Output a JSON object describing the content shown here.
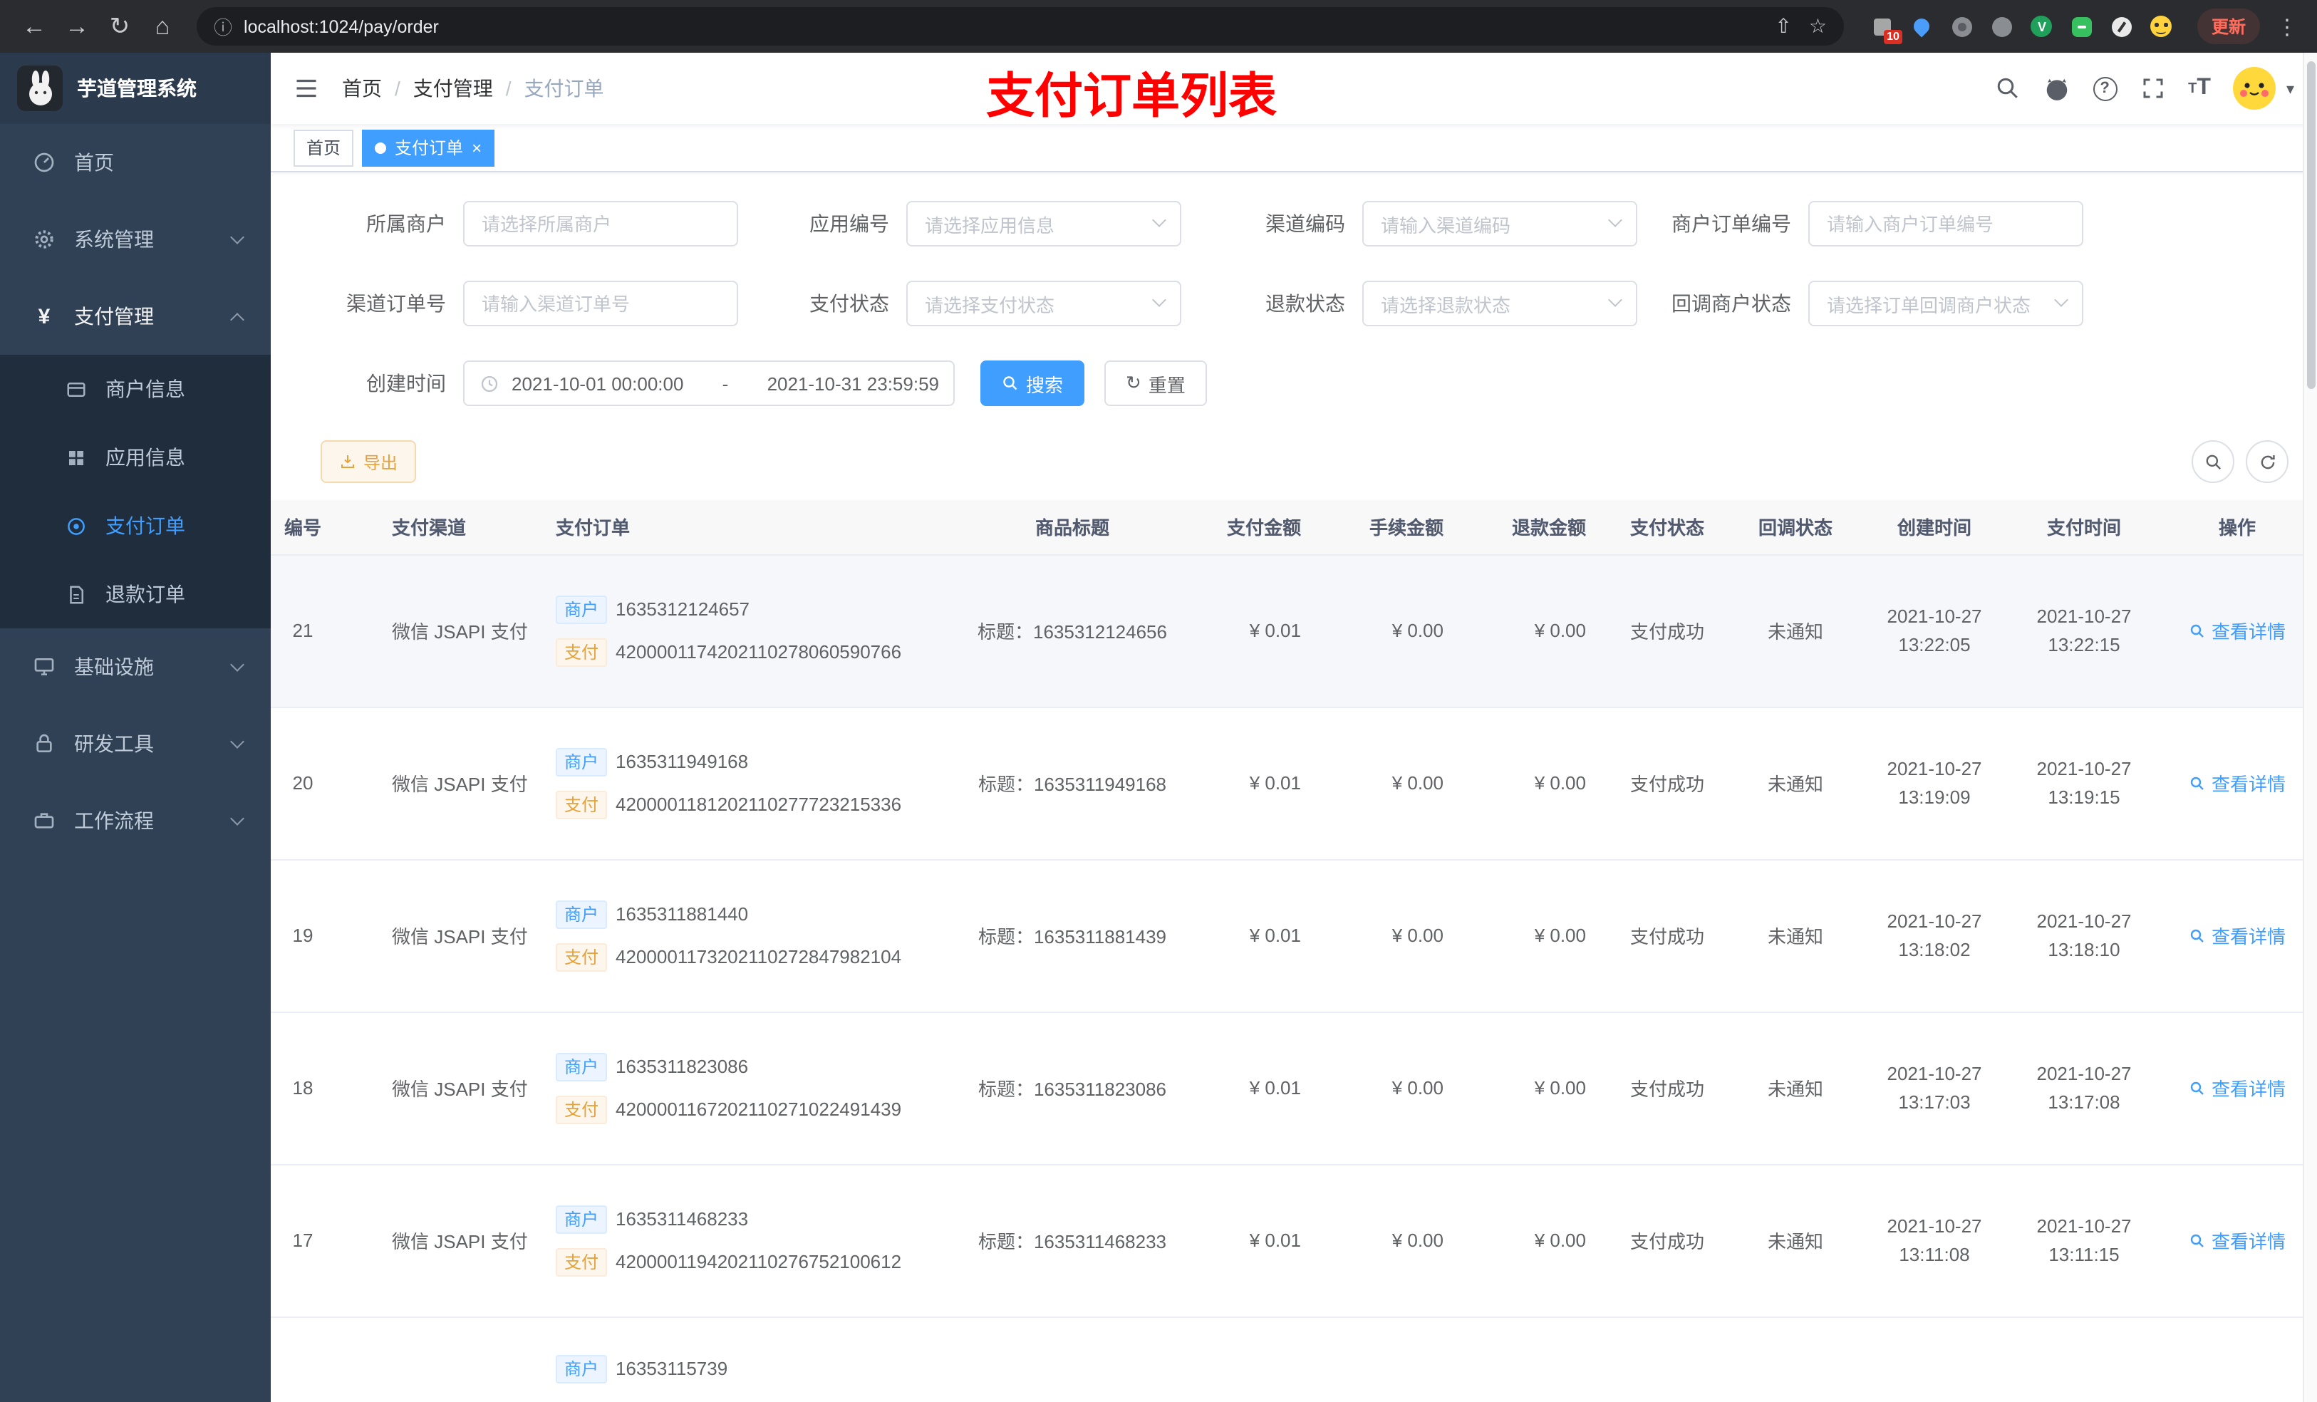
{
  "colors": {
    "primary": "#409eff",
    "warning": "#e6a23c",
    "annotation": "#ff0000",
    "sidebar_bg": "#304156",
    "submenu_bg": "#1f2d3d"
  },
  "icons": {
    "back": "←",
    "forward": "→",
    "reload": "↻",
    "home": "⌂",
    "info": "ⓘ",
    "share": "⇧",
    "star": "☆",
    "menu": "⋮",
    "yen": "¥",
    "help": "?",
    "caret": "▾",
    "close": "×",
    "fontsize_large": "T",
    "fontsize_small": "T",
    "ext_v": "V",
    "reset_glyph": "↻"
  },
  "browser": {
    "url": "localhost:1024/pay/order",
    "ext_badge": "10",
    "update": "更新"
  },
  "sidebar": {
    "title": "芋道管理系统",
    "menu": [
      {
        "label": "首页"
      },
      {
        "label": "系统管理"
      },
      {
        "label": "支付管理"
      },
      {
        "label": "基础设施"
      },
      {
        "label": "研发工具"
      },
      {
        "label": "工作流程"
      }
    ],
    "submenu": [
      {
        "label": "商户信息"
      },
      {
        "label": "应用信息"
      },
      {
        "label": "支付订单"
      },
      {
        "label": "退款订单"
      }
    ]
  },
  "navbar": {
    "breadcrumb": [
      "首页",
      "支付管理",
      "支付订单"
    ],
    "sep": "/",
    "annotation": "支付订单列表"
  },
  "tabs": [
    {
      "label": "首页"
    },
    {
      "label": "支付订单"
    }
  ],
  "filters": {
    "merchant": {
      "label": "所属商户",
      "placeholder": "请选择所属商户"
    },
    "app": {
      "label": "应用编号",
      "placeholder": "请选择应用信息"
    },
    "channel_code": {
      "label": "渠道编码",
      "placeholder": "请输入渠道编码"
    },
    "merchant_order_no": {
      "label": "商户订单编号",
      "placeholder": "请输入商户订单编号"
    },
    "channel_order_no": {
      "label": "渠道订单号",
      "placeholder": "请输入渠道订单号"
    },
    "pay_status": {
      "label": "支付状态",
      "placeholder": "请选择支付状态"
    },
    "refund_status": {
      "label": "退款状态",
      "placeholder": "请选择退款状态"
    },
    "notify_status": {
      "label": "回调商户状态",
      "placeholder": "请选择订单回调商户状态"
    },
    "create_time": {
      "label": "创建时间",
      "start": "2021-10-01 00:00:00",
      "separator": "-",
      "end": "2021-10-31 23:59:59"
    },
    "search": "搜索",
    "reset": "重置"
  },
  "toolbar": {
    "export": "导出"
  },
  "table": {
    "headers": [
      "编号",
      "支付渠道",
      "支付订单",
      "商品标题",
      "支付金额",
      "手续金额",
      "退款金额",
      "支付状态",
      "回调状态",
      "创建时间",
      "支付时间",
      "操作"
    ],
    "tag_merchant": "商户",
    "tag_pay": "支付",
    "rows": [
      {
        "id": "21",
        "channel": "微信 JSAPI 支付",
        "merchant_no": "1635312124657",
        "channel_no": "4200001174202110278060590766",
        "title": "标题：1635312124656",
        "amount": "¥ 0.01",
        "fee": "¥ 0.00",
        "refund": "¥ 0.00",
        "status": "支付成功",
        "notify": "未通知",
        "create_date": "2021-10-27",
        "create_time": "13:22:05",
        "pay_date": "2021-10-27",
        "pay_time": "13:22:15",
        "action": "查看详情"
      },
      {
        "id": "20",
        "channel": "微信 JSAPI 支付",
        "merchant_no": "1635311949168",
        "channel_no": "4200001181202110277723215336",
        "title": "标题：1635311949168",
        "amount": "¥ 0.01",
        "fee": "¥ 0.00",
        "refund": "¥ 0.00",
        "status": "支付成功",
        "notify": "未通知",
        "create_date": "2021-10-27",
        "create_time": "13:19:09",
        "pay_date": "2021-10-27",
        "pay_time": "13:19:15",
        "action": "查看详情"
      },
      {
        "id": "19",
        "channel": "微信 JSAPI 支付",
        "merchant_no": "1635311881440",
        "channel_no": "4200001173202110272847982104",
        "title": "标题：1635311881439",
        "amount": "¥ 0.01",
        "fee": "¥ 0.00",
        "refund": "¥ 0.00",
        "status": "支付成功",
        "notify": "未通知",
        "create_date": "2021-10-27",
        "create_time": "13:18:02",
        "pay_date": "2021-10-27",
        "pay_time": "13:18:10",
        "action": "查看详情"
      },
      {
        "id": "18",
        "channel": "微信 JSAPI 支付",
        "merchant_no": "1635311823086",
        "channel_no": "4200001167202110271022491439",
        "title": "标题：1635311823086",
        "amount": "¥ 0.01",
        "fee": "¥ 0.00",
        "refund": "¥ 0.00",
        "status": "支付成功",
        "notify": "未通知",
        "create_date": "2021-10-27",
        "create_time": "13:17:03",
        "pay_date": "2021-10-27",
        "pay_time": "13:17:08",
        "action": "查看详情"
      },
      {
        "id": "17",
        "channel": "微信 JSAPI 支付",
        "merchant_no": "1635311468233",
        "channel_no": "4200001194202110276752100612",
        "title": "标题：1635311468233",
        "amount": "¥ 0.01",
        "fee": "¥ 0.00",
        "refund": "¥ 0.00",
        "status": "支付成功",
        "notify": "未通知",
        "create_date": "2021-10-27",
        "create_time": "13:11:08",
        "pay_date": "2021-10-27",
        "pay_time": "13:11:15",
        "action": "查看详情"
      }
    ],
    "partial_row": {
      "merchant_no": "16353115739"
    }
  }
}
